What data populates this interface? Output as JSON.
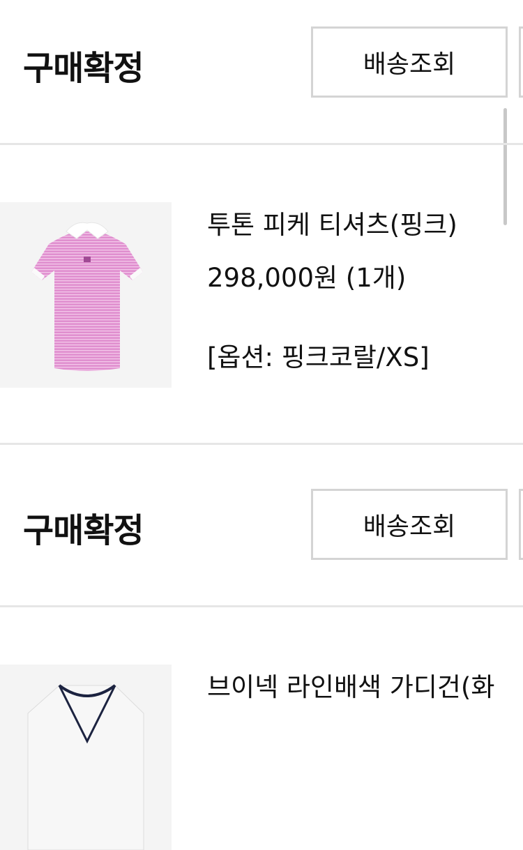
{
  "orders": [
    {
      "status": "구매확정",
      "button_label": "배송조회",
      "product": {
        "name": "투톤 피케 티셔츠(핑크)",
        "price": "298,000원 (1개)",
        "option": "[옵션: 핑크코랄/XS]",
        "image_icon": "pink-polo-shirt-image"
      }
    },
    {
      "status": "구매확정",
      "button_label": "배송조회",
      "product": {
        "name": "브이넥 라인배색 가디건(화",
        "image_icon": "white-cardigan-image"
      }
    }
  ],
  "colors": {
    "shirt_pink": "#e08fcf",
    "divider": "#e6e6e6",
    "button_border": "#d4d4d4"
  }
}
